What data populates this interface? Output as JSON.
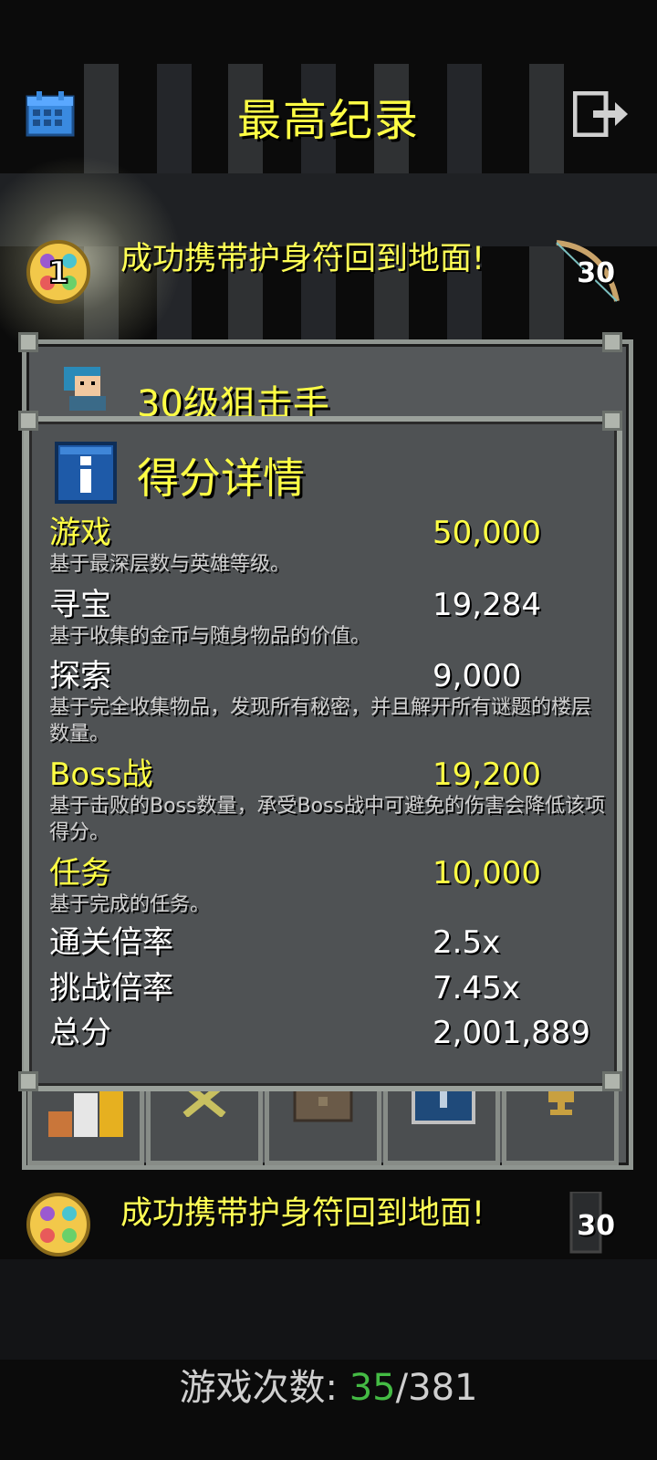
{
  "header": {
    "title": "最高纪录",
    "calendar_icon": "calendar-icon",
    "exit_icon": "exit-icon"
  },
  "records": [
    {
      "rank": "1",
      "text": "成功携带护身符回到地面!",
      "level": "30",
      "medal": "amulet-medal"
    },
    {
      "rank": "",
      "text": "成功携带护身符回到地面!",
      "level": "30",
      "medal": "amulet-medal"
    }
  ],
  "back_window": {
    "title": "30级狙击手"
  },
  "score_window": {
    "title": "得分详情",
    "rows": [
      {
        "label": "游戏",
        "value": "50,000",
        "desc": "基于最深层数与英雄等级。",
        "highlight": true
      },
      {
        "label": "寻宝",
        "value": "19,284",
        "desc": "基于收集的金币与随身物品的价值。",
        "highlight": false
      },
      {
        "label": "探索",
        "value": "9,000",
        "desc": "基于完全收集物品，发现所有秘密，并且解开所有谜题的楼层数量。",
        "highlight": false
      },
      {
        "label": "Boss战",
        "value": "19,200",
        "desc": "基于击败的Boss数量，承受Boss战中可避免的伤害会降低该项得分。",
        "highlight": true
      },
      {
        "label": "任务",
        "value": "10,000",
        "desc": "基于完成的任务。",
        "highlight": true
      }
    ],
    "multipliers": [
      {
        "label": "通关倍率",
        "value": "2.5x"
      },
      {
        "label": "挑战倍率",
        "value": "7.45x"
      },
      {
        "label": "总分",
        "value": "2,001,889"
      }
    ]
  },
  "footer": {
    "label": "游戏次数:",
    "current": "35",
    "total": "/381"
  },
  "colors": {
    "accent_yellow": "#ffff44",
    "panel": "#4f5254",
    "border": "#9aa09a",
    "count_green": "#44bb44"
  }
}
